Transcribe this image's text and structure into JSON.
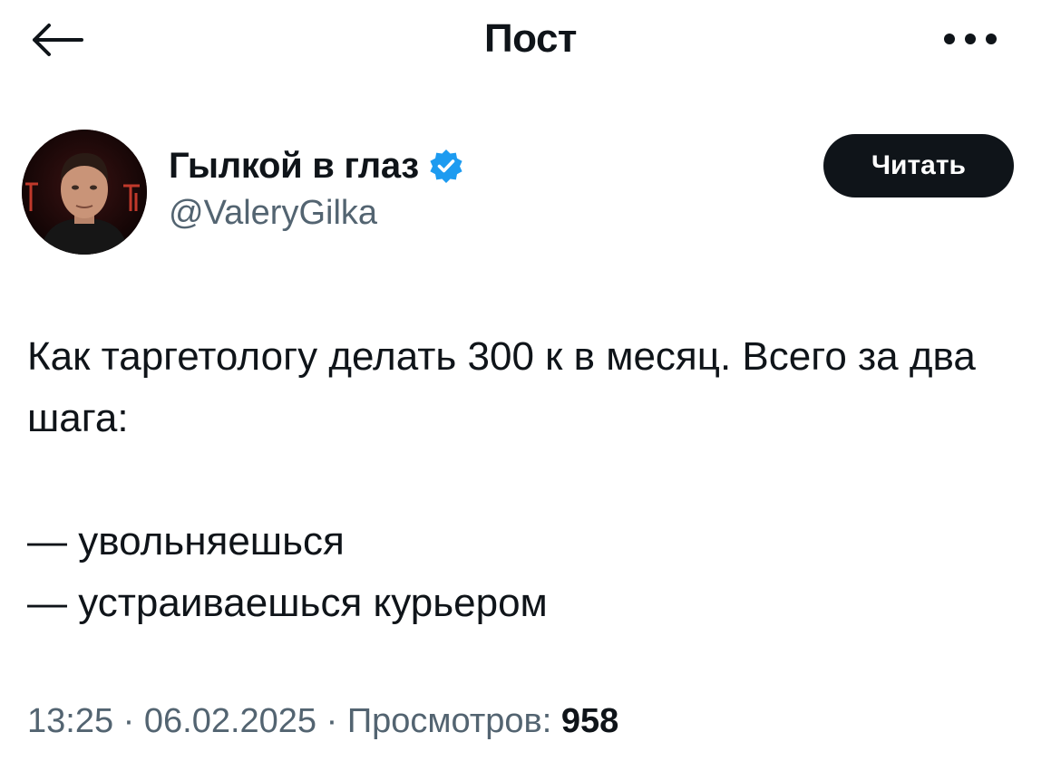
{
  "header": {
    "title": "Пост",
    "back_icon": "arrow-left-icon",
    "more_icon": "more-horizontal-icon"
  },
  "author": {
    "name": "Гылкой в глаз",
    "handle": "@ValeryGilka",
    "verified": true,
    "verified_color": "#1d9bf0",
    "follow_label": "Читать"
  },
  "post": {
    "lines": [
      "Как таргетологу делать 300 к в месяц. Всего за два шага:",
      "— увольняешься",
      "— устраиваешься курьером"
    ]
  },
  "meta": {
    "time": "13:25",
    "date": "06.02.2025",
    "views_label": "Просмотров:",
    "views_count": "958",
    "separator": "·"
  },
  "colors": {
    "text": "#0f1419",
    "secondary": "#536471",
    "button_bg": "#0f1419",
    "button_text": "#ffffff"
  }
}
